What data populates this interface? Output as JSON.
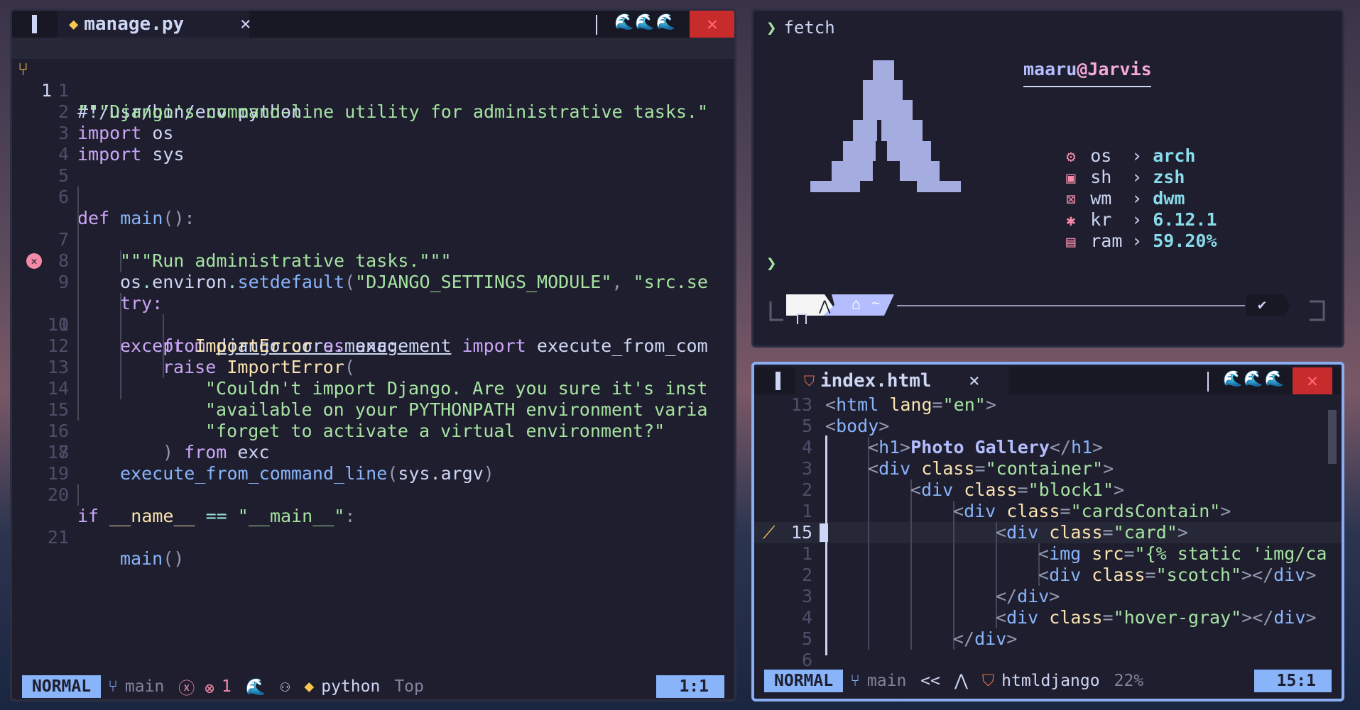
{
  "nvim": {
    "tab": {
      "name": "manage.py",
      "close": "×",
      "icon": "python-icon",
      "waves": "🌊🌊🌊",
      "x": "✕"
    },
    "lines": [
      {
        "n": "1",
        "cur": true,
        "git": "⑂"
      },
      {
        "n": "1"
      },
      {
        "n": "2"
      },
      {
        "n": "3"
      },
      {
        "n": "4"
      },
      {
        "n": "5"
      },
      {
        "n": "6"
      },
      {
        "n": "7"
      },
      {
        "n": "8"
      },
      {
        "n": "9"
      },
      {
        "n": "10",
        "err": true
      },
      {
        "n": "11"
      },
      {
        "n": "12"
      },
      {
        "n": "13"
      },
      {
        "n": "14"
      },
      {
        "n": "15"
      },
      {
        "n": "16"
      },
      {
        "n": "17"
      },
      {
        "n": "18"
      },
      {
        "n": "19"
      },
      {
        "n": "20"
      },
      {
        "n": "21"
      }
    ],
    "code": {
      "l0": "#!/usr/bin/env python",
      "l1": "\"\"\"Django's command-line utility for administrative tasks.\"",
      "l2a": "import",
      "l2b": " os",
      "l3a": "import",
      "l3b": " sys",
      "l6a": "def",
      "l6b": " main",
      "l6c": "():",
      "l7": "\"\"\"Run administrative tasks.\"\"\"",
      "l8a": "os",
      "l8b": ".",
      "l8c": "environ",
      "l8d": ".",
      "l8e": "setdefault",
      "l8f": "(",
      "l8g": "\"DJANGO_SETTINGS_MODULE\"",
      "l8h": ", ",
      "l8i": "\"src.se",
      "l9": "try:",
      "l10a": "from",
      "l10b": " ",
      "l10c": "django.core.management",
      "l10d": " import",
      "l10e": " execute_from_com",
      "l11a": "except",
      "l11b": " ImportError",
      "l11c": " as",
      "l11d": " exc:",
      "l12a": "raise",
      "l12b": " ImportError",
      "l12c": "(",
      "l13": "\"Couldn't import Django. Are you sure it's inst",
      "l14": "\"available on your PYTHONPATH environment varia",
      "l15": "\"forget to activate a virtual environment?\"",
      "l16a": ")",
      "l16b": " from",
      "l16c": " exc",
      "l17a": "execute_from_command_line",
      "l17b": "(",
      "l17c": "sys.argv",
      "l17d": ")",
      "l20a": "if",
      "l20b": " __name__",
      "l20c": " ==",
      "l20d": " \"__main__\"",
      "l20e": ":",
      "l21a": "main",
      "l21b": "()"
    },
    "status": {
      "mode": "NORMAL",
      "branch_icon": "⑂",
      "branch": "main",
      "err_icons": "ⓧ ⊗",
      "err_count": "1",
      "wave": "🌊",
      "copilot": "⚇",
      "lang": "python",
      "scroll": "Top",
      "pos": "1:1"
    }
  },
  "terminal": {
    "prompt": "❯",
    "command": "fetch",
    "user": "maaru",
    "at": "@",
    "host": "Jarvis",
    "rows": [
      {
        "icon": "⚙",
        "key": "os",
        "arrow": "›",
        "val": "arch"
      },
      {
        "icon": "▣",
        "key": "sh",
        "arrow": "›",
        "val": "zsh"
      },
      {
        "icon": "⊠",
        "key": "wm",
        "arrow": "›",
        "val": "dwm"
      },
      {
        "icon": "✱",
        "key": "kr",
        "arrow": "›",
        "val": "6.12.1"
      },
      {
        "icon": "▤",
        "key": "ram",
        "arrow": "›",
        "val": "59.20%"
      }
    ],
    "prompt2": "❯",
    "pl_home": "~",
    "pl_check": "✔",
    "colors": {
      "logo": "#a5acdf",
      "user": "#b4befe",
      "host": "#f5a9d6"
    }
  },
  "html_editor": {
    "tab": {
      "name": "index.html",
      "close": "×",
      "waves": "🌊🌊🌊",
      "x": "✕"
    },
    "lines": [
      {
        "n": "13",
        "t": [
          [
            "<",
            "br"
          ],
          [
            "html",
            "tag"
          ],
          [
            " lang",
            "attr"
          ],
          [
            "=",
            "br"
          ],
          [
            "\"en\"",
            "str"
          ],
          [
            ">",
            "br"
          ]
        ],
        "i": 0
      },
      {
        "n": "5",
        "t": [
          [
            "<",
            "br"
          ],
          [
            "body",
            "tag"
          ],
          [
            ">",
            "br"
          ]
        ],
        "i": 0
      },
      {
        "n": "4",
        "t": [
          [
            "<",
            "br"
          ],
          [
            "h1",
            "tag"
          ],
          [
            ">",
            "br"
          ],
          [
            "Photo Gallery",
            "bold"
          ],
          [
            "</",
            "br"
          ],
          [
            "h1",
            "tag"
          ],
          [
            ">",
            "br"
          ]
        ],
        "i": 1
      },
      {
        "n": "3",
        "t": [
          [
            "<",
            "br"
          ],
          [
            "div",
            "tag"
          ],
          [
            " class",
            "attr"
          ],
          [
            "=",
            "br"
          ],
          [
            "\"container\"",
            "str"
          ],
          [
            ">",
            "br"
          ]
        ],
        "i": 1
      },
      {
        "n": "2",
        "t": [
          [
            "<",
            "br"
          ],
          [
            "div",
            "tag"
          ],
          [
            " class",
            "attr"
          ],
          [
            "=",
            "br"
          ],
          [
            "\"block1\"",
            "str"
          ],
          [
            ">",
            "br"
          ]
        ],
        "i": 2
      },
      {
        "n": "1",
        "t": [
          [
            "<",
            "br"
          ],
          [
            "div",
            "tag"
          ],
          [
            " class",
            "attr"
          ],
          [
            "=",
            "br"
          ],
          [
            "\"cardsContain\"",
            "str"
          ],
          [
            ">",
            "br"
          ]
        ],
        "i": 3
      },
      {
        "n": "15",
        "cur": true,
        "t": [
          [
            "<",
            "br"
          ],
          [
            "div",
            "tag"
          ],
          [
            " class",
            "attr"
          ],
          [
            "=",
            "br"
          ],
          [
            "\"card\"",
            "str"
          ],
          [
            ">",
            "br"
          ]
        ],
        "i": 4
      },
      {
        "n": "1",
        "t": [
          [
            "<",
            "br"
          ],
          [
            "img",
            "tag"
          ],
          [
            " src",
            "attr"
          ],
          [
            "=",
            "br"
          ],
          [
            "\"{% static 'img/ca",
            "str"
          ]
        ],
        "i": 5
      },
      {
        "n": "2",
        "t": [
          [
            "<",
            "br"
          ],
          [
            "div",
            "tag"
          ],
          [
            " class",
            "attr"
          ],
          [
            "=",
            "br"
          ],
          [
            "\"scotch\"",
            "str"
          ],
          [
            "></",
            "br"
          ],
          [
            "div",
            "tag"
          ],
          [
            ">",
            "br"
          ]
        ],
        "i": 5
      },
      {
        "n": "3",
        "t": [
          [
            "</",
            "br"
          ],
          [
            "div",
            "tag"
          ],
          [
            ">",
            "br"
          ]
        ],
        "i": 4
      },
      {
        "n": "4",
        "t": [
          [
            "<",
            "br"
          ],
          [
            "div",
            "tag"
          ],
          [
            " class",
            "attr"
          ],
          [
            "=",
            "br"
          ],
          [
            "\"hover-gray\"",
            "str"
          ],
          [
            "></",
            "br"
          ],
          [
            "div",
            "tag"
          ],
          [
            ">",
            "br"
          ]
        ],
        "i": 4
      },
      {
        "n": "5",
        "t": [
          [
            "</",
            "br"
          ],
          [
            "div",
            "tag"
          ],
          [
            ">",
            "br"
          ]
        ],
        "i": 3
      },
      {
        "n": "6",
        "t": [],
        "i": 0
      }
    ],
    "status": {
      "mode": "NORMAL",
      "branch_icon": "⑂",
      "branch": "main",
      "arrows": "<<",
      "lang": "htmldjango",
      "scroll": "22%",
      "pos": "15:1"
    }
  }
}
